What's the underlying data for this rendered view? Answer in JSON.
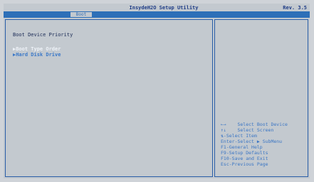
{
  "header": {
    "title": "InsydeH2O Setup Utility",
    "revision": "Rev. 3.5"
  },
  "tabs": [
    {
      "label": "Boot",
      "active": true
    }
  ],
  "main": {
    "section_title": "Boot Device Priority",
    "items": [
      {
        "label": "▶Boot Type Order",
        "highlighted": true
      },
      {
        "label": "▶Hard Disk Drive",
        "highlighted": false
      }
    ]
  },
  "help": {
    "lines": [
      "←→    Select Boot Device",
      "↑↓    Select Screen",
      "⇅-Select Item",
      "Enter-Select ▶ SubMenu",
      "F1-General Help",
      "F9-Setup Defaults",
      "F10-Save and Exit",
      "Esc-Previous Page"
    ]
  },
  "colors": {
    "background": "#c3c9cf",
    "tab_bar": "#2d6fb8",
    "text": "#1a3f88",
    "highlight": "#eef2f8"
  }
}
